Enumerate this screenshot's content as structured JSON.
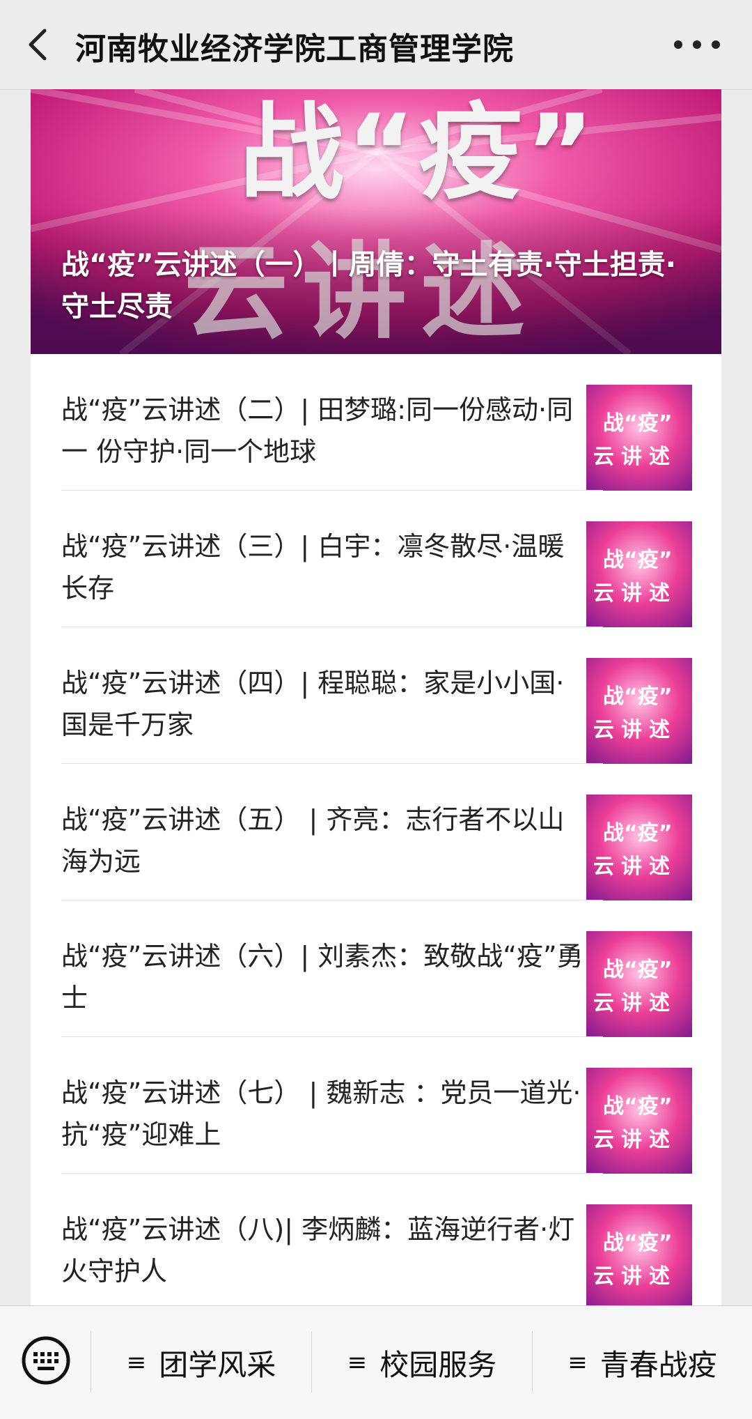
{
  "nav": {
    "title": "河南牧业经济学院工商管理学院",
    "back_icon": "chevron-left-icon",
    "more_icon": "more-dots-icon"
  },
  "banner": {
    "big_line1": "战“疫”",
    "big_line2": "云讲述",
    "caption": "战“疫”云讲述（一）丨周倩：守土有责·守土担责· 守土尽责"
  },
  "thumbnail": {
    "line1": "战“疫”",
    "line2": "云讲述"
  },
  "articles": [
    {
      "title": "战“疫”云讲述（二）| 田梦璐:同一份感动·同一 份守护·同一个地球"
    },
    {
      "title": "战“疫”云讲述（三）| 白宇：凛冬散尽·温暖长存"
    },
    {
      "title": "战“疫”云讲述（四）| 程聪聪：家是小小国·国是千万家"
    },
    {
      "title": "战“疫”云讲述（五） | 齐亮：志行者不以山海为远"
    },
    {
      "title": "战“疫”云讲述（六）| 刘素杰：致敬战“疫”勇士"
    },
    {
      "title": "战“疫”云讲述（七） | 魏新志 ：党员一道光· 抗“疫”迎难上"
    },
    {
      "title": "战“疫”云讲述（八)| 李炳麟：蓝海逆行者·灯火守护人"
    }
  ],
  "bottom_menu": {
    "keyboard_icon": "keyboard-icon",
    "items": [
      {
        "label": "团学风采",
        "icon": "≡"
      },
      {
        "label": "校园服务",
        "icon": "≡"
      },
      {
        "label": "青春战疫",
        "icon": "≡"
      }
    ]
  },
  "colors": {
    "accent_pink": "#e8318a",
    "accent_purple": "#8a1d8f"
  }
}
